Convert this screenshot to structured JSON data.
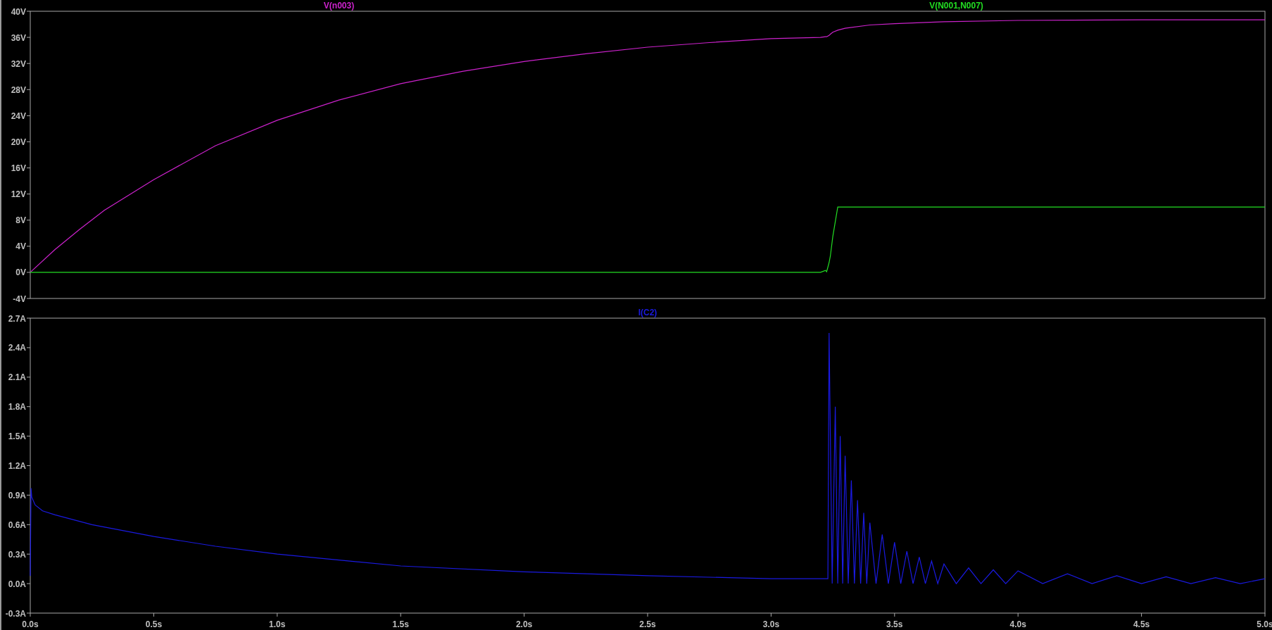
{
  "panes": [
    {
      "chart_data": {
        "type": "line",
        "x": [
          0,
          0.1,
          0.2,
          0.3,
          0.5,
          0.75,
          1.0,
          1.25,
          1.5,
          1.75,
          2.0,
          2.25,
          2.5,
          2.75,
          3.0,
          3.2,
          3.22,
          3.225,
          3.23,
          3.235,
          3.24,
          3.25,
          3.27,
          3.3,
          3.4,
          3.5,
          3.7,
          4.0,
          4.5,
          5.0
        ],
        "series": [
          {
            "name": "V(n003)",
            "color": "#cc22cc",
            "values": [
              0,
              3.5,
              6.6,
              9.5,
              14.2,
              19.4,
              23.3,
              26.4,
              28.9,
              30.8,
              32.3,
              33.5,
              34.5,
              35.2,
              35.8,
              36.0,
              36.1,
              36.1,
              36.2,
              36.3,
              36.5,
              36.8,
              37.1,
              37.4,
              37.9,
              38.1,
              38.4,
              38.6,
              38.7,
              38.7
            ]
          },
          {
            "name": "V(N001,N007)",
            "color": "#22dd22",
            "values": [
              0,
              0,
              0,
              0,
              0,
              0,
              0,
              0,
              0,
              0,
              0,
              0,
              0,
              0,
              0,
              0,
              0.3,
              0.1,
              0.8,
              1.5,
              2.5,
              5.5,
              10,
              10,
              10,
              10,
              10,
              10,
              10,
              10
            ]
          }
        ],
        "xlim": [
          0,
          5
        ],
        "ylim": [
          -4,
          40
        ],
        "yticks": [
          {
            "value": 40,
            "label": "40V"
          },
          {
            "value": 36,
            "label": "36V"
          },
          {
            "value": 32,
            "label": "32V"
          },
          {
            "value": 28,
            "label": "28V"
          },
          {
            "value": 24,
            "label": "24V"
          },
          {
            "value": 20,
            "label": "20V"
          },
          {
            "value": 16,
            "label": "16V"
          },
          {
            "value": 12,
            "label": "12V"
          },
          {
            "value": 8,
            "label": "8V"
          },
          {
            "value": 4,
            "label": "4V"
          },
          {
            "value": 0,
            "label": "0V"
          },
          {
            "value": -4,
            "label": "-4V"
          }
        ]
      }
    },
    {
      "chart_data": {
        "type": "line",
        "x": [
          0,
          0.003,
          0.006,
          0.02,
          0.05,
          0.1,
          0.25,
          0.5,
          0.75,
          1.0,
          1.5,
          2.0,
          2.5,
          3.0,
          3.22,
          3.23,
          3.235,
          3.2475,
          3.26,
          3.27,
          3.28,
          3.29,
          3.3,
          3.3125,
          3.325,
          3.3375,
          3.35,
          3.3625,
          3.375,
          3.3875,
          3.4,
          3.425,
          3.45,
          3.475,
          3.5,
          3.525,
          3.55,
          3.575,
          3.6,
          3.625,
          3.65,
          3.675,
          3.7,
          3.75,
          3.8,
          3.85,
          3.9,
          3.95,
          4.0,
          4.1,
          4.2,
          4.3,
          4.4,
          4.5,
          4.6,
          4.7,
          4.8,
          4.9,
          5.0
        ],
        "series": [
          {
            "name": "I(C2)",
            "color": "#1a1ae0",
            "values": [
              0.08,
              0.97,
              0.88,
              0.8,
              0.74,
              0.7,
              0.6,
              0.48,
              0.38,
              0.3,
              0.18,
              0.12,
              0.08,
              0.05,
              0.05,
              0.05,
              2.55,
              0.0,
              1.8,
              0.0,
              1.5,
              0.0,
              1.3,
              0.0,
              1.05,
              0.0,
              0.85,
              0.0,
              0.72,
              0.0,
              0.62,
              0.0,
              0.5,
              0.0,
              0.42,
              0.0,
              0.33,
              0.0,
              0.27,
              0.0,
              0.23,
              0.0,
              0.2,
              0.0,
              0.16,
              0.0,
              0.14,
              0.0,
              0.13,
              0.0,
              0.1,
              0.0,
              0.08,
              0.0,
              0.07,
              0.0,
              0.06,
              0.0,
              0.05
            ]
          }
        ],
        "xlim": [
          0,
          5
        ],
        "ylim": [
          -0.3,
          2.7
        ],
        "xticks": [
          {
            "value": 0,
            "label": "0.0s"
          },
          {
            "value": 0.5,
            "label": "0.5s"
          },
          {
            "value": 1,
            "label": "1.0s"
          },
          {
            "value": 1.5,
            "label": "1.5s"
          },
          {
            "value": 2,
            "label": "2.0s"
          },
          {
            "value": 2.5,
            "label": "2.5s"
          },
          {
            "value": 3,
            "label": "3.0s"
          },
          {
            "value": 3.5,
            "label": "3.5s"
          },
          {
            "value": 4,
            "label": "4.0s"
          },
          {
            "value": 4.5,
            "label": "4.5s"
          },
          {
            "value": 5,
            "label": "5.0s"
          }
        ],
        "yticks": [
          {
            "value": 2.7,
            "label": "2.7A"
          },
          {
            "value": 2.4,
            "label": "2.4A"
          },
          {
            "value": 2.1,
            "label": "2.1A"
          },
          {
            "value": 1.8,
            "label": "1.8A"
          },
          {
            "value": 1.5,
            "label": "1.5A"
          },
          {
            "value": 1.2,
            "label": "1.2A"
          },
          {
            "value": 0.9,
            "label": "0.9A"
          },
          {
            "value": 0.6,
            "label": "0.6A"
          },
          {
            "value": 0.3,
            "label": "0.3A"
          },
          {
            "value": 0,
            "label": "0.0A"
          },
          {
            "value": -0.3,
            "label": "-0.3A"
          }
        ]
      }
    }
  ]
}
